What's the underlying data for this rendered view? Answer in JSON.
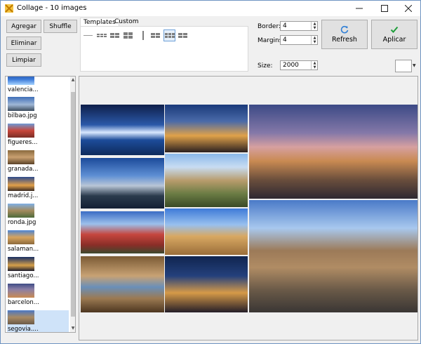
{
  "window": {
    "title": "Collage - 10 images"
  },
  "buttons": {
    "add": "Agregar",
    "shuffle": "Shuffle",
    "remove": "Eliminar",
    "clear": "Limpiar",
    "refresh": "Refresh",
    "apply": "Aplicar"
  },
  "tabs": [
    {
      "label": "Templates"
    },
    {
      "label": "Custom"
    }
  ],
  "settings": {
    "border_label": "Border:",
    "border_value": "4",
    "margins_label": "Margins:",
    "margins_value": "4",
    "size_label": "Size:",
    "size_value": "2000"
  },
  "images": [
    {
      "name": "valencia..."
    },
    {
      "name": "bilbao.jpg"
    },
    {
      "name": "figueres..."
    },
    {
      "name": "granada..."
    },
    {
      "name": "madrid.j..."
    },
    {
      "name": "ronda.jpg"
    },
    {
      "name": "salaman..."
    },
    {
      "name": "santiago..."
    },
    {
      "name": "barcelon..."
    },
    {
      "name": "segovia...."
    }
  ],
  "icons": {
    "app": "collage-icon",
    "refresh": "refresh-icon",
    "apply": "checkmark-icon"
  },
  "colors": {
    "accent": "#0078d7",
    "apply_check": "#1e9e3a",
    "refresh_icon": "#2f7fd6",
    "selection": "#cfe3f9"
  }
}
